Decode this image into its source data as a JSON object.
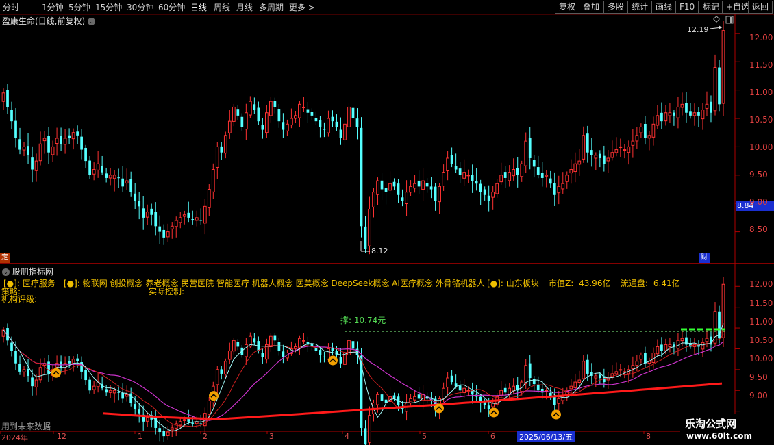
{
  "toolbar": {
    "periods": [
      "分时",
      "1分钟",
      "5分钟",
      "15分钟",
      "30分钟",
      "60分钟",
      "日线",
      "周线",
      "月线",
      "多周期",
      "更多"
    ],
    "active": "日线",
    "right_buttons": [
      "复权",
      "叠加",
      "多股",
      "统计",
      "画线",
      "F10",
      "标记",
      "+自选",
      "返回"
    ]
  },
  "upper_panel": {
    "title": "盈康生命(日线,前复权)",
    "high_label": "12.19",
    "low_label": "8.12",
    "current_price_tag": "8.84",
    "left_tag": "定",
    "right_tag": "财",
    "y_ticks": [
      "12.00",
      "11.50",
      "11.00",
      "10.50",
      "10.00",
      "9.50",
      "9.00",
      "8.50"
    ]
  },
  "lower_panel": {
    "title": "股朋指标网",
    "info_row": {
      "industry": "[●]: 医疗服务",
      "concepts": "[●]: 物联网 创投概念 养老概念 民营医院 智能医疗 机器人概念 医美概念 DeepSeek概念 AI医疗概念 外骨骼机器人",
      "region": "[●]: 山东板块",
      "market_cap_label": "市值Z:",
      "market_cap": "43.96亿",
      "float_label": "流通盘:",
      "float": "6.41亿"
    },
    "strategy_label": "策略:",
    "control_label": "实际控制:",
    "rating_label": "机构评级:",
    "support_label": "撑: 10.74元",
    "future_note": "用到未来数据",
    "y_ticks": [
      "12.00",
      "11.50",
      "11.00",
      "10.50",
      "10.00",
      "9.50",
      "9.00"
    ]
  },
  "x_axis": {
    "labels": [
      "2024年",
      "12",
      "1",
      "2",
      "3",
      "4",
      "5",
      "6",
      "2025/06/13/五",
      "8"
    ]
  },
  "watermark": {
    "line1": "乐淘公式网",
    "line2": "www.60lt.com"
  },
  "colors": {
    "up": "#ff3232",
    "down": "#54ffff",
    "bg": "#000000",
    "grid": "#7a0000",
    "support_line": "#ff1a1a",
    "ma_cyan": "#9ff5f5",
    "ma_magenta": "#cc33cc",
    "ma_red": "#d02020",
    "green_line": "#33ff33"
  },
  "chart_data": {
    "type": "candlestick",
    "upper": {
      "ylim": [
        8.0,
        12.3
      ],
      "closes": [
        10.95,
        10.7,
        10.45,
        10.15,
        9.95,
        10.0,
        9.85,
        9.6,
        9.75,
        10.05,
        10.15,
        9.9,
        10.0,
        10.15,
        10.05,
        10.15,
        10.15,
        10.25,
        10.2,
        9.95,
        9.75,
        9.5,
        9.6,
        9.7,
        9.55,
        9.45,
        9.5,
        9.5,
        9.45,
        9.3,
        9.4,
        9.2,
        9.05,
        8.95,
        8.75,
        8.85,
        8.8,
        8.6,
        8.5,
        8.4,
        8.5,
        8.6,
        8.7,
        8.75,
        8.8,
        8.75,
        8.7,
        8.75,
        8.7,
        8.95,
        9.25,
        9.6,
        10.0,
        9.9,
        10.2,
        10.45,
        10.7,
        10.55,
        10.35,
        10.6,
        10.8,
        10.65,
        10.45,
        10.3,
        10.6,
        10.8,
        10.7,
        10.45,
        10.3,
        10.4,
        10.5,
        10.55,
        10.75,
        10.7,
        10.6,
        10.55,
        10.45,
        10.35,
        10.3,
        10.5,
        10.45,
        10.35,
        10.15,
        10.4,
        10.7,
        10.5,
        10.35,
        8.6,
        8.2,
        8.9,
        9.2,
        9.4,
        9.25,
        9.2,
        9.35,
        9.3,
        9.15,
        9.05,
        9.2,
        9.3,
        9.35,
        9.3,
        9.4,
        9.3,
        9.25,
        9.05,
        9.3,
        9.55,
        9.8,
        9.7,
        9.6,
        9.5,
        9.55,
        9.5,
        9.4,
        9.35,
        9.2,
        9.15,
        9.05,
        9.2,
        9.35,
        9.5,
        9.45,
        9.55,
        9.6,
        9.5,
        9.7,
        10.1,
        9.8,
        9.65,
        9.5,
        9.45,
        9.5,
        9.35,
        9.15,
        9.3,
        9.35,
        9.5,
        9.6,
        9.7,
        9.75,
        10.2,
        9.9,
        9.85,
        9.85,
        9.8,
        9.7,
        9.8,
        9.9,
        9.95,
        10.0,
        9.95,
        10.0,
        10.1,
        10.2,
        10.35,
        10.15,
        10.2,
        10.4,
        10.55,
        10.45,
        10.6,
        10.6,
        10.55,
        10.7,
        10.75,
        10.6,
        10.55,
        10.6,
        10.55,
        10.65,
        10.75,
        10.6,
        11.4,
        10.75,
        12.05
      ]
    },
    "lower": {
      "ylim": [
        8.55,
        12.35
      ],
      "support_price": 10.74
    }
  }
}
